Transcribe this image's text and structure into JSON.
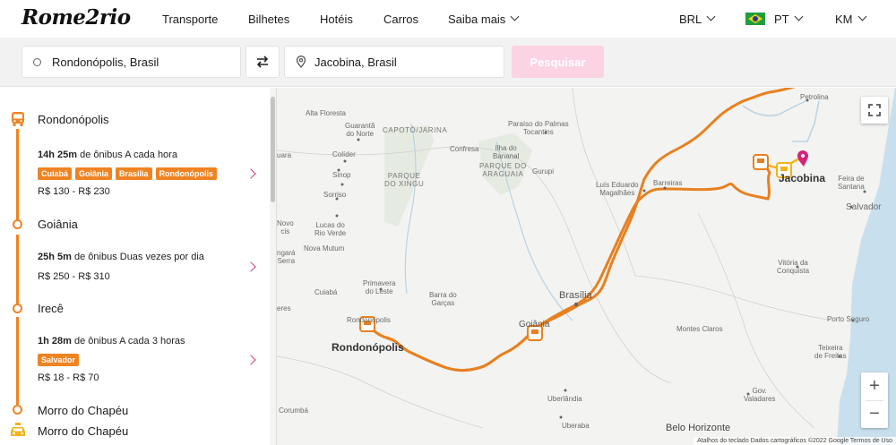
{
  "header": {
    "logo": "Rome2rio",
    "nav": [
      "Transporte",
      "Bilhetes",
      "Hotéis",
      "Carros",
      "Saiba mais"
    ],
    "currency": "BRL",
    "language": "PT",
    "units": "KM"
  },
  "search": {
    "origin": "Rondonópolis, Brasil",
    "destination": "Jacobina, Brasil",
    "button": "Pesquisar"
  },
  "route": {
    "stops": [
      "Rondonópolis",
      "Goiânia",
      "Irecê",
      "Morro do Chapéu",
      "Morro do Chapéu"
    ],
    "segments": [
      {
        "duration": "14h 25m",
        "description": "de ônibus A cada hora",
        "tags": [
          "Cuiabá",
          "Goiânia",
          "Brasília",
          "Rondonópolis"
        ],
        "price": "R$ 130 - R$ 230"
      },
      {
        "duration": "25h 5m",
        "description": "de ônibus Duas vezes por dia",
        "tags": [],
        "price": "R$ 250 - R$ 310"
      },
      {
        "duration": "1h 28m",
        "description": "de ônibus A cada 3 horas",
        "tags": [
          "Salvador"
        ],
        "price": "R$ 18 - R$ 70"
      }
    ]
  },
  "map": {
    "labels": {
      "petrolina": "Petrolina",
      "alta_floresta": "Alta Floresta",
      "guaranta": "Guarantã\ndo Norte",
      "capoto": "CAPOTÓ/JARINA",
      "paraiso": "Paraíso do Palmas\nTocantins",
      "uara": "uara",
      "colider": "Colíder",
      "confresa": "Confresa",
      "ilha": "Ilha do\nBananal",
      "parque_xingu": "PARQUE\nDO XINGU",
      "parque_araguaia": "PARQUE DO\nARAGUAIA",
      "gurupi": "Gurupi",
      "sinop": "Sinop",
      "sorriso": "Sorriso",
      "luis_eduardo": "Luís Eduardo\nMagalhães",
      "barreiras": "Barreiras",
      "jacobina": "Jacobina",
      "feira": "Feira de\nSantana",
      "salvador": "Salvador",
      "novo": "Novo\ncis",
      "lucas": "Lucas do\nRio Verde",
      "nova_mutum": "Nova Mutum",
      "vitoria": "Vitória da\nConquista",
      "ngara": "ngará\nSerra",
      "cuiaba": "Cuiabá",
      "primavera": "Primavera\ndo Leste",
      "barra": "Barra do\nGarças",
      "brasilia": "Brasília",
      "eres": "eres",
      "rondonopolis_small": "Rondonópolis",
      "rondonopolis": "Rondonópolis",
      "goiania": "Goiânia",
      "montes_claros": "Montes Claros",
      "porto_seguro": "Porto Seguro",
      "teixeira": "Teixeira\nde Freitas",
      "uberlandia": "Uberlândia",
      "gov": "Gov.\nValadares",
      "corumba": "Corumbá",
      "uberaba": "Uberaba",
      "belo": "Belo Horizonte"
    },
    "attribution": "Atalhos do teclado   Dados cartográficos ©2022 Google   Termos de Uso",
    "zoom_in": "+",
    "zoom_out": "−",
    "colors": {
      "route": "#e8801f",
      "taxi": "#f2b21b",
      "pin": "#d4237a"
    }
  }
}
